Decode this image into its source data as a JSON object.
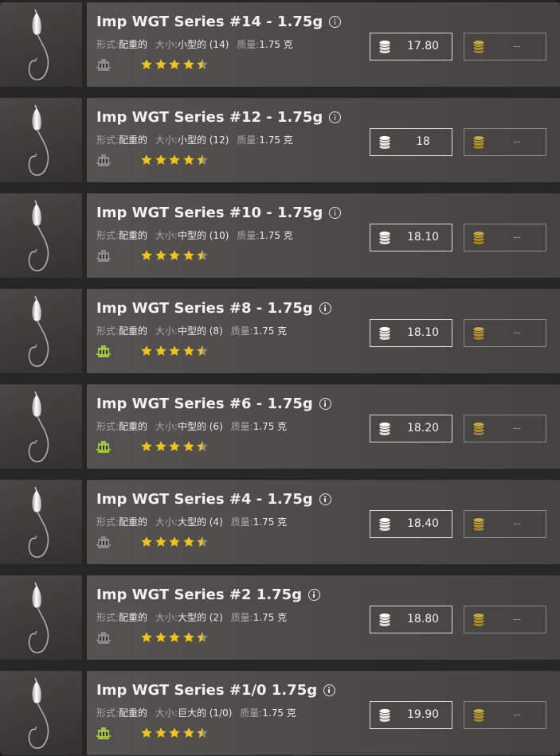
{
  "labels": {
    "form": "形式:",
    "size": "大小:",
    "mass": "质量:"
  },
  "colors": {
    "star": "#f0c22a",
    "star_empty": "#8f8d88",
    "badge_active": "#a6c23a",
    "badge_inactive": "#8a8a8a",
    "silver_coin": "#dcdcdc",
    "gold_coin": "#b69a3a"
  },
  "items": [
    {
      "title": "Imp WGT Series #14 - 1.75g",
      "form": "配重的",
      "size": "小型的 (14)",
      "mass": "1.75 克",
      "rating": 4.5,
      "badge_active": false,
      "silver_price": "17.80",
      "gold_price": "--",
      "info_icon": "info-icon",
      "silver_icon": "silver-coins-icon",
      "gold_icon": "gold-coins-icon"
    },
    {
      "title": "Imp WGT Series #12 - 1.75g",
      "form": "配重的",
      "size": "小型的 (12)",
      "mass": "1.75 克",
      "rating": 4.5,
      "badge_active": false,
      "silver_price": "18",
      "gold_price": "--",
      "info_icon": "info-icon",
      "silver_icon": "silver-coins-icon",
      "gold_icon": "gold-coins-icon"
    },
    {
      "title": "Imp WGT Series #10 - 1.75g",
      "form": "配重的",
      "size": "中型的 (10)",
      "mass": "1.75 克",
      "rating": 4.5,
      "badge_active": false,
      "silver_price": "18.10",
      "gold_price": "--",
      "info_icon": "info-icon",
      "silver_icon": "silver-coins-icon",
      "gold_icon": "gold-coins-icon"
    },
    {
      "title": "Imp WGT Series #8 - 1.75g",
      "form": "配重的",
      "size": "中型的 (8)",
      "mass": "1.75 克",
      "rating": 4.5,
      "badge_active": true,
      "silver_price": "18.10",
      "gold_price": "--",
      "info_icon": "info-icon",
      "silver_icon": "silver-coins-icon",
      "gold_icon": "gold-coins-icon"
    },
    {
      "title": "Imp WGT Series #6 - 1.75g",
      "form": "配重的",
      "size": "中型的 (6)",
      "mass": "1.75 克",
      "rating": 4.5,
      "badge_active": true,
      "silver_price": "18.20",
      "gold_price": "--",
      "info_icon": "info-icon",
      "silver_icon": "silver-coins-icon",
      "gold_icon": "gold-coins-icon"
    },
    {
      "title": "Imp WGT Series #4 - 1.75g",
      "form": "配重的",
      "size": "大型的 (4)",
      "mass": "1.75 克",
      "rating": 4.5,
      "badge_active": false,
      "silver_price": "18.40",
      "gold_price": "--",
      "info_icon": "info-icon",
      "silver_icon": "silver-coins-icon",
      "gold_icon": "gold-coins-icon"
    },
    {
      "title": "Imp WGT Series #2 1.75g",
      "form": "配重的",
      "size": "大型的 (2)",
      "mass": "1.75 克",
      "rating": 4.5,
      "badge_active": false,
      "silver_price": "18.80",
      "gold_price": "--",
      "info_icon": "info-icon",
      "silver_icon": "silver-coins-icon",
      "gold_icon": "gold-coins-icon"
    },
    {
      "title": "Imp WGT Series #1/0 1.75g",
      "form": "配重的",
      "size": "巨大的 (1/0)",
      "mass": "1.75 克",
      "rating": 4.5,
      "badge_active": true,
      "silver_price": "19.90",
      "gold_price": "--",
      "info_icon": "info-icon",
      "silver_icon": "silver-coins-icon",
      "gold_icon": "gold-coins-icon"
    }
  ]
}
